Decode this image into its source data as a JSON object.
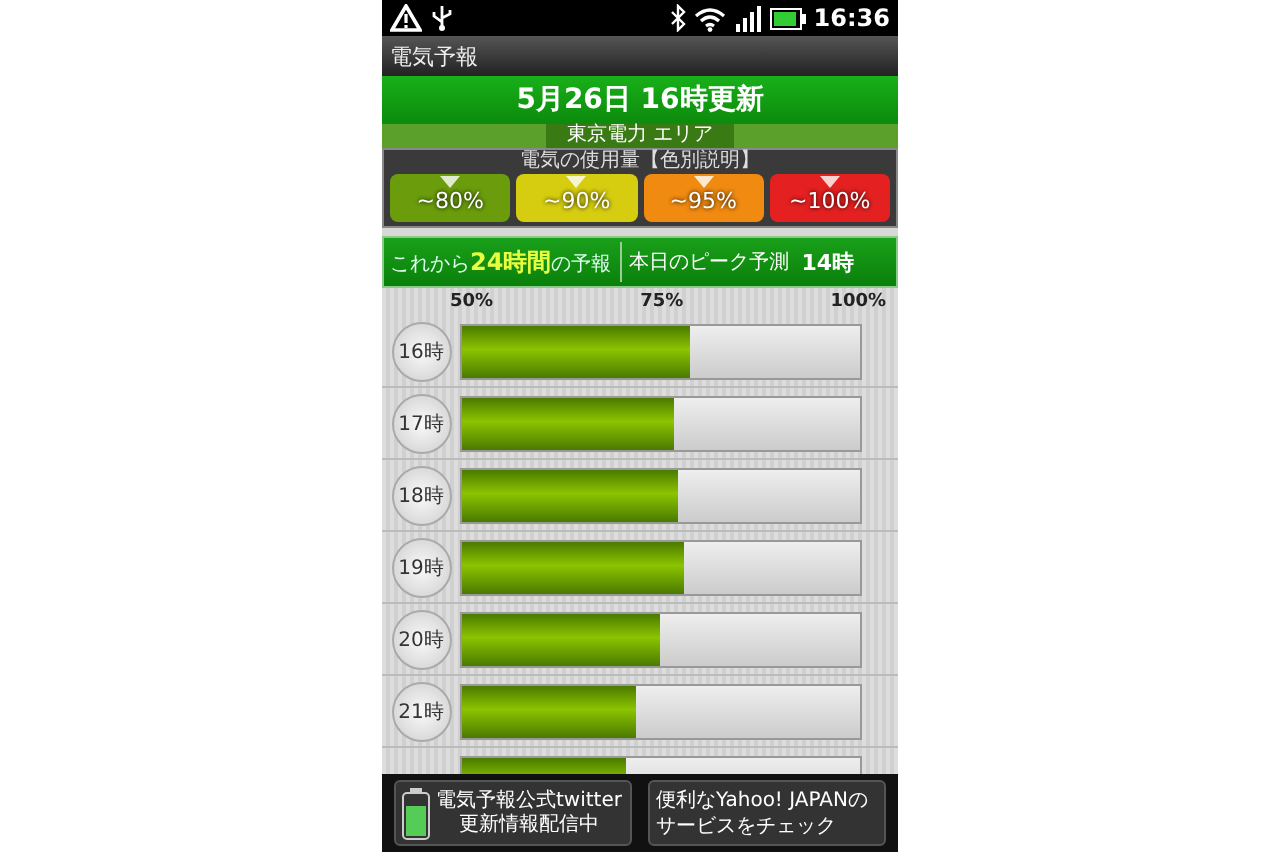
{
  "status_bar": {
    "time": "16:36"
  },
  "app_title": "電気予報",
  "header": {
    "updated": "5月26日 16時更新",
    "area": "東京電力 エリア"
  },
  "legend": {
    "title": "電気の使用量【色別説明】",
    "items": [
      {
        "label": "~80%",
        "color": "#6a9c0c"
      },
      {
        "label": "~90%",
        "color": "#d6cc10"
      },
      {
        "label": "~95%",
        "color": "#f08a10"
      },
      {
        "label": "~100%",
        "color": "#e42020"
      }
    ]
  },
  "forecast": {
    "title": "これから**24時間**の予報",
    "peak_label": "本日のピーク予測",
    "peak_value": "14時"
  },
  "scale": [
    "50%",
    "75%",
    "100%"
  ],
  "rows": [
    {
      "hour": "16時",
      "level": 0.575
    },
    {
      "hour": "17時",
      "level": 0.535
    },
    {
      "hour": "18時",
      "level": 0.545
    },
    {
      "hour": "19時",
      "level": 0.56
    },
    {
      "hour": "20時",
      "level": 0.495
    },
    {
      "hour": "21時",
      "level": 0.435
    },
    {
      "level": 0.41
    }
  ],
  "ads": [
    {
      "kind": "twitter",
      "title": "電気予報公式twitter",
      "subtitle": "更新情報配信中"
    },
    {
      "kind": "yahoo",
      "lines": [
        "便利なYahoo! JAPANの",
        "サービスをチェック"
      ]
    }
  ]
}
